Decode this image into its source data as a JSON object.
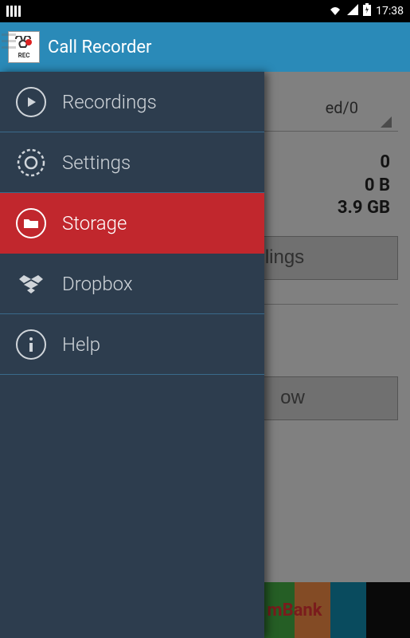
{
  "status": {
    "time": "17:38"
  },
  "header": {
    "title": "Call Recorder"
  },
  "drawer": {
    "items": [
      {
        "label": "Recordings",
        "icon": "play"
      },
      {
        "label": "Settings",
        "icon": "gear"
      },
      {
        "label": "Storage",
        "icon": "folder",
        "selected": true
      },
      {
        "label": "Dropbox",
        "icon": "dropbox"
      },
      {
        "label": "Help",
        "icon": "info"
      }
    ]
  },
  "main": {
    "spinner_text": "ed/0",
    "stats": {
      "count": "0",
      "size": "0 B",
      "free": "3.9 GB"
    },
    "btn1_partial": "lings",
    "btn2_partial": "ow",
    "ad_text": "mBank"
  }
}
